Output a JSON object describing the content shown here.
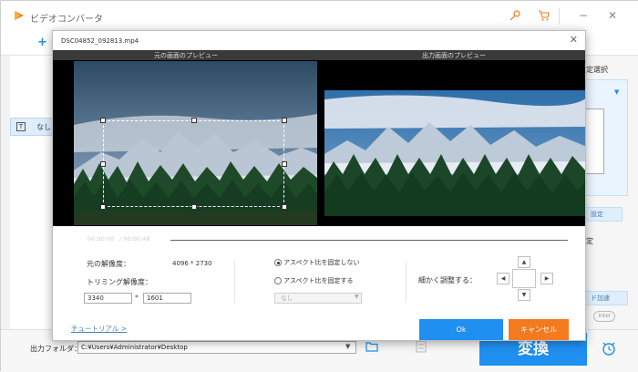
{
  "app": {
    "title": "ビデオコンバータ",
    "subtitle_option": "なし",
    "right_panel": {
      "format_label": "定選択",
      "settings_label": "設定",
      "label2": "定",
      "hw_accel": "ド加速",
      "intel_badge": "Intel"
    },
    "output": {
      "label": "出力フォルダ：",
      "path": "C:¥Users¥Administrator¥Desktop"
    },
    "convert_label": "変換",
    "accent_color": "#1f8ff0"
  },
  "dialog": {
    "title": "DSC04852_092813.mp4",
    "original_preview_label": "元の画面のプレビュー",
    "output_preview_label": "出力画面のプレビュー",
    "playback": {
      "current_time": "00:00:00",
      "total_time": "/  00:00:48",
      "progress": 0
    },
    "original_resolution_label": "元の解像度：",
    "original_resolution_value": "4096 * 2730",
    "trim_resolution_label": "トリミング解像度：",
    "trim_width": "3340",
    "trim_height": "1601",
    "separator": "*",
    "aspect_free_label": "アスペクト比を固定しない",
    "aspect_fixed_label": "アスペクト比を固定する",
    "aspect_select_value": "なし",
    "aspect_free_checked": true,
    "fine_adjust_label": "細かく調整する：",
    "tutorial_link": "チュートリアル >",
    "ok_label": "Ok",
    "cancel_label": "キャンセル",
    "ok_color": "#1f8ff0",
    "cancel_color": "#f47a1f"
  }
}
